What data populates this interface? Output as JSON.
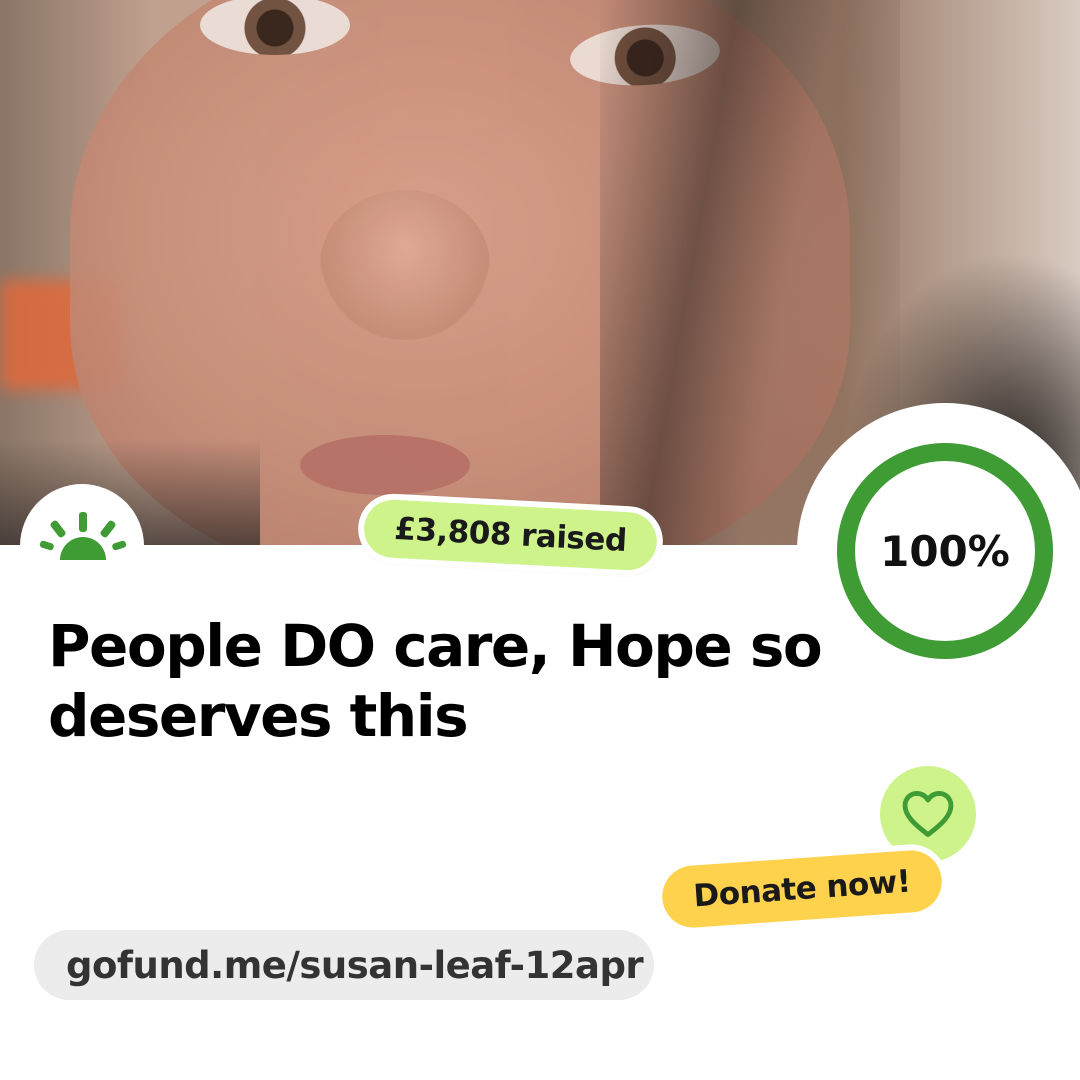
{
  "hero": {
    "icon": "portrait-photo"
  },
  "logo": {
    "icon": "gofundme-sunrise-logo",
    "color": "#3f9c35"
  },
  "raised": {
    "label": "£3,808 raised",
    "color": "#cdf38a"
  },
  "progress": {
    "percent_label": "100%",
    "value": 1.0,
    "ring_color": "#3f9c35"
  },
  "title": "People DO care, Hope so deserves this",
  "heart": {
    "icon": "heart-icon",
    "color": "#cdf38a"
  },
  "donate": {
    "label": "Donate now!",
    "color": "#ffd24d"
  },
  "link": {
    "url": "gofund.me/susan-leaf-12apr"
  }
}
